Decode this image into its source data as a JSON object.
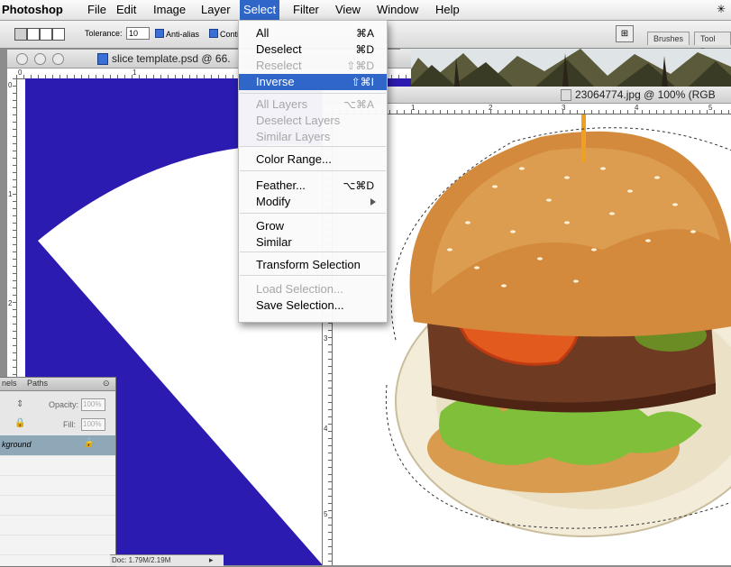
{
  "menubar": {
    "app": "Photoshop",
    "items": [
      "File",
      "Edit",
      "Image",
      "Layer",
      "Select",
      "Filter",
      "View",
      "Window",
      "Help"
    ],
    "active": "Select"
  },
  "options": {
    "tolerance_label": "Tolerance:",
    "tolerance_value": "10",
    "antialias": "Anti-alias",
    "contiguous": "Conti"
  },
  "palette_tabs": [
    "Brushes",
    "Tool Pre"
  ],
  "left_window": {
    "title": "slice template.psd @ 66.",
    "ruler_labels": [
      "0",
      "1"
    ],
    "ruler_v_labels": [
      "0",
      "1",
      "2"
    ],
    "canvas_color": "#2b1bb0"
  },
  "right_window": {
    "title": "23064774.jpg @ 100% (RGB",
    "ruler_labels": [
      "1",
      "2",
      "3",
      "4",
      "5"
    ],
    "ruler_v_labels": [
      "3",
      "4",
      "5",
      "6"
    ]
  },
  "layers": {
    "tabs": [
      "nels",
      "Paths"
    ],
    "opacity_label": "Opacity:",
    "opacity_value": "100%",
    "fill_label": "Fill:",
    "fill_value": "100%",
    "background_layer": "kground"
  },
  "status": "Doc: 1.79M/2.19M",
  "select_menu": [
    {
      "label": "All",
      "shortcut": "⌘A",
      "enabled": true
    },
    {
      "label": "Deselect",
      "shortcut": "⌘D",
      "enabled": true
    },
    {
      "label": "Reselect",
      "shortcut": "⇧⌘D",
      "enabled": false
    },
    {
      "label": "Inverse",
      "shortcut": "⇧⌘I",
      "enabled": true,
      "highlighted": true
    },
    {
      "label": "All Layers",
      "shortcut": "⌥⌘A",
      "enabled": false
    },
    {
      "label": "Deselect Layers",
      "shortcut": "",
      "enabled": false
    },
    {
      "label": "Similar Layers",
      "shortcut": "",
      "enabled": false
    },
    {
      "label": "Color Range...",
      "shortcut": "",
      "enabled": true
    },
    {
      "label": "Feather...",
      "shortcut": "⌥⌘D",
      "enabled": true
    },
    {
      "label": "Modify",
      "shortcut": "",
      "enabled": true,
      "submenu": true
    },
    {
      "label": "Grow",
      "shortcut": "",
      "enabled": true
    },
    {
      "label": "Similar",
      "shortcut": "",
      "enabled": true
    },
    {
      "label": "Transform Selection",
      "shortcut": "",
      "enabled": true
    },
    {
      "label": "Load Selection...",
      "shortcut": "",
      "enabled": false
    },
    {
      "label": "Save Selection...",
      "shortcut": "",
      "enabled": true
    }
  ]
}
